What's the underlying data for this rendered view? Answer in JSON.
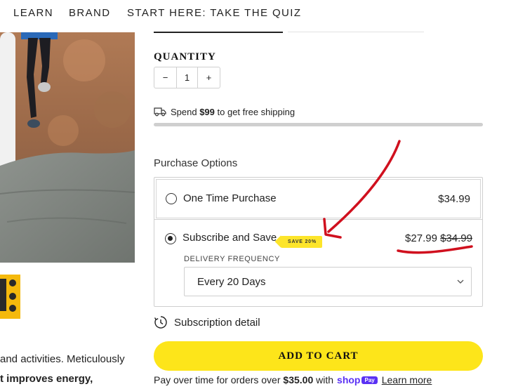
{
  "nav": {
    "items": [
      "LEARN",
      "BRAND",
      "START HERE: TAKE THE QUIZ"
    ]
  },
  "description": {
    "line1": "and activities. Meticulously",
    "line2": "t improves energy,"
  },
  "quantity": {
    "label": "QUANTITY",
    "minus": "−",
    "value": "1",
    "plus": "+"
  },
  "shipping": {
    "prefix": "Spend ",
    "amount": "$99",
    "suffix": " to get free shipping",
    "progress_fraction": 0
  },
  "purchase_options": {
    "label": "Purchase Options",
    "one_time": {
      "label": "One Time Purchase",
      "price": "$34.99",
      "selected": false
    },
    "subscribe": {
      "label": "Subscribe and Save",
      "badge": "SAVE 20%",
      "price": "$27.99",
      "original_price": "$34.99",
      "selected": true,
      "frequency_label": "DELIVERY FREQUENCY",
      "frequency_value": "Every 20 Days"
    }
  },
  "subscription_detail": "Subscription detail",
  "add_to_cart": "ADD TO CART",
  "pay_over_time": {
    "prefix": "Pay over time for orders over ",
    "amount": "$35.00",
    "with": " with",
    "shop_logo": "shop",
    "pay_badge": "Pay",
    "learn_more": "Learn more"
  },
  "colors": {
    "accent_yellow": "#fde51a",
    "annotation_red": "#d0101e",
    "shop_purple": "#5a31f4"
  },
  "icons": {
    "shipping": "truck-icon",
    "subscription": "clock-refresh-icon",
    "select": "chevron-down-icon"
  }
}
